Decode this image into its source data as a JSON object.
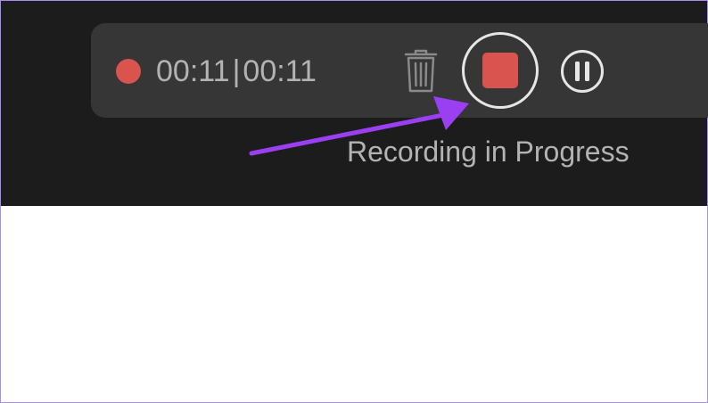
{
  "recorder": {
    "elapsed_time": "00:11",
    "separator": "|",
    "total_time": "00:11",
    "status_caption": "Recording in Progress"
  },
  "icons": {
    "record_indicator": "record-dot-icon",
    "delete": "trash-icon",
    "stop": "stop-icon",
    "pause": "pause-icon",
    "annotation": "arrow-icon"
  },
  "colors": {
    "background": "#1c1c1c",
    "toolbar": "#363636",
    "record_red": "#d9534f",
    "text_gray": "#b3b3b3",
    "annotation_arrow": "#9b3ff2",
    "frame_border": "#a78bfa"
  }
}
